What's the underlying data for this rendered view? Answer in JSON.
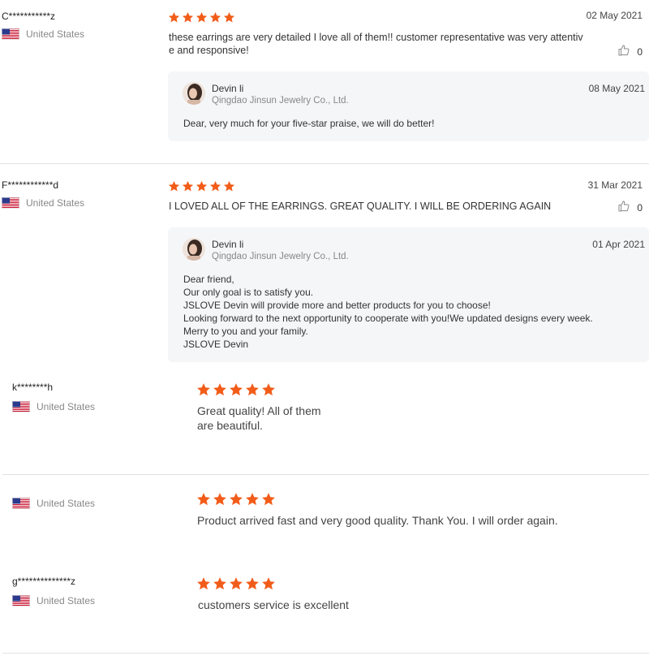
{
  "colors": {
    "star": "#f25c19",
    "divider": "#e2e2e2",
    "reply_bg": "#f5f6f8",
    "muted_text": "#888888"
  },
  "reviews": [
    {
      "reviewer": "C***********z",
      "country": "United States",
      "rating": 5,
      "date": "02 May 2021",
      "text_line1": "these earrings are very detailed I love all of them!! customer representative was very attentiv",
      "text_line2": "e and responsive!",
      "likes": "0",
      "reply": {
        "name": "Devin li",
        "company": "Qingdao Jinsun Jewelry Co., Ltd.",
        "date": "08 May 2021",
        "lines": [
          "Dear,  very much for your five-star praise, we will do better!"
        ]
      }
    },
    {
      "reviewer": "F************d",
      "country": "United States",
      "rating": 5,
      "date": "31 Mar 2021",
      "text_line1": "I LOVED ALL OF THE EARRINGS. GREAT QUALITY. I WILL BE ORDERING AGAIN",
      "likes": "0",
      "reply": {
        "name": "Devin li",
        "company": "Qingdao Jinsun Jewelry Co., Ltd.",
        "date": "01 Apr 2021",
        "lines": [
          "Dear friend,",
          "Our only goal is to satisfy you.",
          "JSLOVE Devin will provide more and better products for you to choose!",
          "Looking forward to the next opportunity to cooperate with you!We updated designs every week.",
          "Merry  to you and your family.",
          "JSLOVE Devin"
        ]
      }
    },
    {
      "reviewer": "k********h",
      "country": "United States",
      "rating": 5,
      "text_line1": "Great quality! All of them",
      "text_line2": "are beautiful."
    },
    {
      "reviewer": "",
      "country": "United States",
      "rating": 5,
      "text_line1": "Product arrived fast and very good quality. Thank You. I will order again."
    },
    {
      "reviewer": "g**************z",
      "country": "United States",
      "rating": 5,
      "text_line1": "customers service is excellent"
    }
  ]
}
